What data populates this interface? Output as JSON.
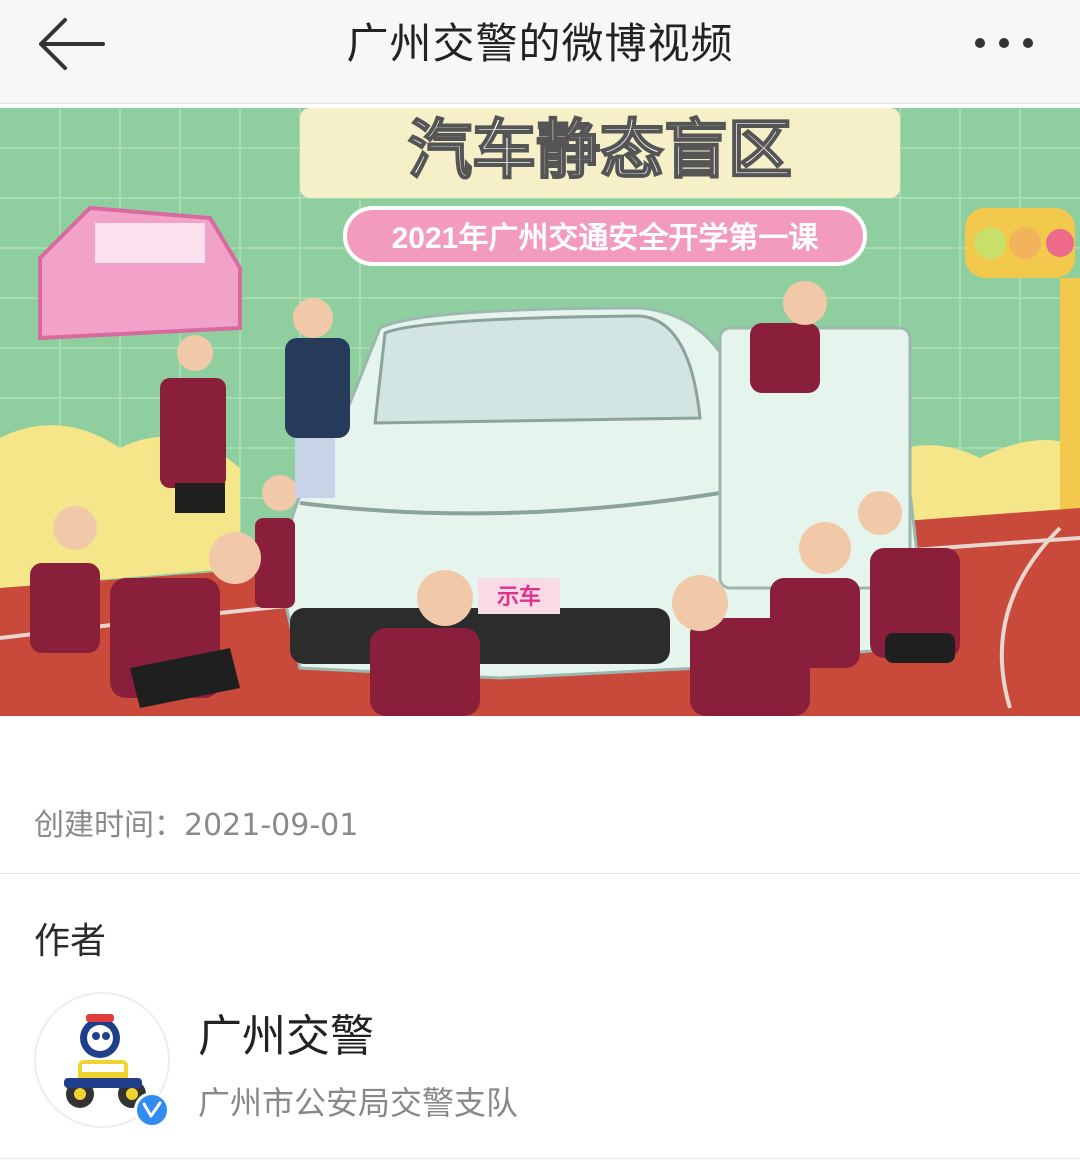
{
  "nav": {
    "title": "广州交警的微博视频",
    "back_icon": "arrow-left-icon",
    "more_icon": "more-dots-icon"
  },
  "video": {
    "banner_title": "汽车静态盲区",
    "banner_subtitle": "2021年广州交通安全开学第一课",
    "plate_text": "示车",
    "colors": {
      "background": "#8fcf9f",
      "track": "#c94a3a",
      "uniform": "#8a1f3b",
      "car": "#e6f4ee"
    }
  },
  "meta": {
    "created_label": "创建时间：2021-09-01"
  },
  "author_section": {
    "title": "作者",
    "name": "广州交警",
    "description": "广州市公安局交警支队",
    "avatar_icon": "robot-police-avatar-icon",
    "verified_icon": "verified-badge-icon",
    "verified_color": "#2f8cf0"
  }
}
